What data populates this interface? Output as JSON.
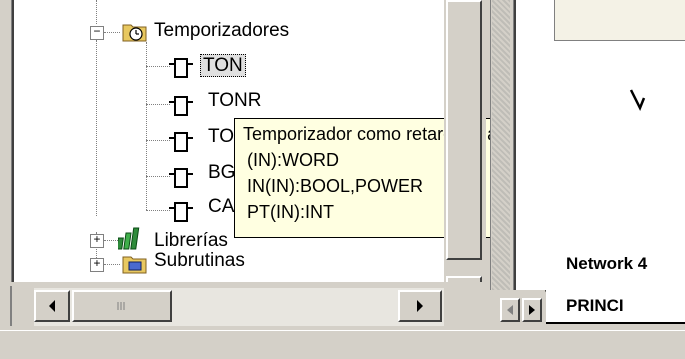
{
  "tree": {
    "folder_label": "Temporizadores",
    "items": [
      {
        "label": "TON",
        "selected": true
      },
      {
        "label": "TONR",
        "selected": false
      },
      {
        "label": "TOF",
        "selected": false
      },
      {
        "label": "BGN_ITIME",
        "selected": false
      },
      {
        "label": "CAL_ITIME",
        "selected": false
      }
    ],
    "libraries_label": "Librerías",
    "subroutines_label": "Subrutinas"
  },
  "tooltip": {
    "title": "Temporizador como retardo a la conexión",
    "lines": [
      "(IN):WORD",
      "IN(IN):BOOL,POWER",
      "PT(IN):INT"
    ]
  },
  "editor": {
    "network_label": "Network 4",
    "tab_label": "PRINCI"
  },
  "colors": {
    "tooltip_bg": "#ffffe1",
    "chrome": "#d4d0c8",
    "library_icon": "#2e8b3a"
  }
}
